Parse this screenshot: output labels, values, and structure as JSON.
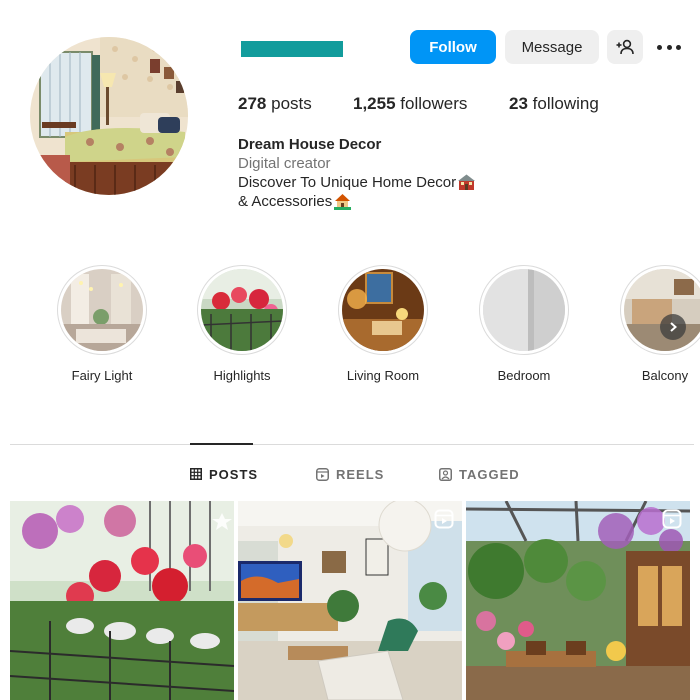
{
  "profile": {
    "avatar_icon": "profile-photo-bedroom",
    "username_redacted_color": "#129c9c"
  },
  "actions": {
    "follow_label": "Follow",
    "message_label": "Message",
    "add_user_icon": "add-person-icon",
    "more_icon": "more-options-icon"
  },
  "stats": {
    "posts_count": "278",
    "posts_label": "posts",
    "followers_count": "1,255",
    "followers_label": "followers",
    "following_count": "23",
    "following_label": "following"
  },
  "bio": {
    "name": "Dream House Decor",
    "category": "Digital creator",
    "line1": "Discover To Unique Home Decor",
    "line2": "& Accessories"
  },
  "highlights": [
    {
      "label": "Fairy Light"
    },
    {
      "label": "Highlights"
    },
    {
      "label": "Living Room"
    },
    {
      "label": "Bedroom"
    },
    {
      "label": "Balcony"
    }
  ],
  "tabs": [
    {
      "label": "POSTS",
      "icon": "grid-icon",
      "active": true
    },
    {
      "label": "REELS",
      "icon": "reels-icon",
      "active": false
    },
    {
      "label": "TAGGED",
      "icon": "tagged-icon",
      "active": false
    }
  ],
  "colors": {
    "accent": "#0095f6",
    "button_bg": "#efefef",
    "text": "#262626",
    "muted": "#737373",
    "border": "#dbdbdb"
  }
}
